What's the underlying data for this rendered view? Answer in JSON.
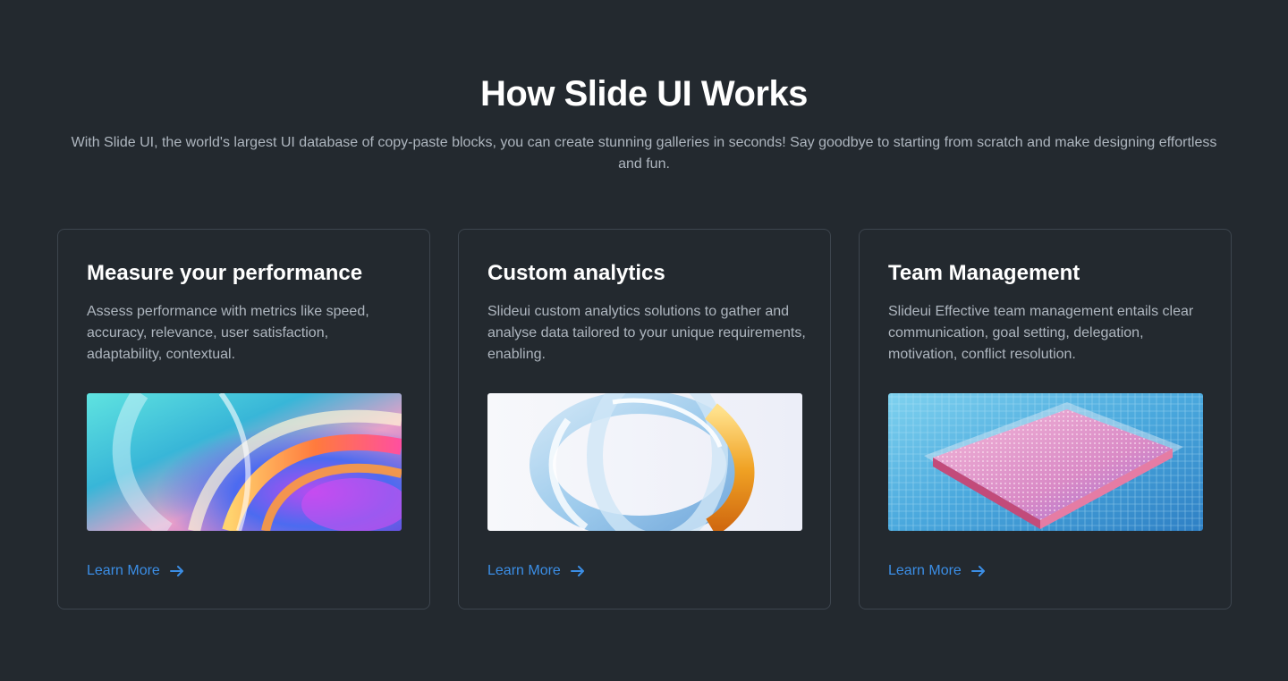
{
  "header": {
    "title": "How Slide UI Works",
    "subtitle": "With Slide UI, the world's largest UI database of copy-paste blocks, you can create stunning galleries in seconds! Say goodbye to starting from scratch and make designing effortless and fun."
  },
  "cards": [
    {
      "title": "Measure your performance",
      "description": "Assess performance with metrics like speed, accuracy, relevance, user satisfaction, adaptability, contextual.",
      "image": "iridescent-swirl-image",
      "link_label": "Learn More"
    },
    {
      "title": "Custom analytics",
      "description": "Slideui custom analytics solutions to gather and analyse data tailored to your unique requirements, enabling.",
      "image": "glass-rings-image",
      "link_label": "Learn More"
    },
    {
      "title": "Team Management",
      "description": "Slideui Effective team management entails clear communication, goal setting, delegation, motivation, conflict resolution.",
      "image": "microchip-image",
      "link_label": "Learn More"
    }
  ],
  "colors": {
    "background": "#23292f",
    "card_border": "#3d454e",
    "link": "#3b8ee6",
    "text_muted": "#aeb6bf"
  },
  "icons": {
    "link_icon": "arrow-right-icon"
  }
}
